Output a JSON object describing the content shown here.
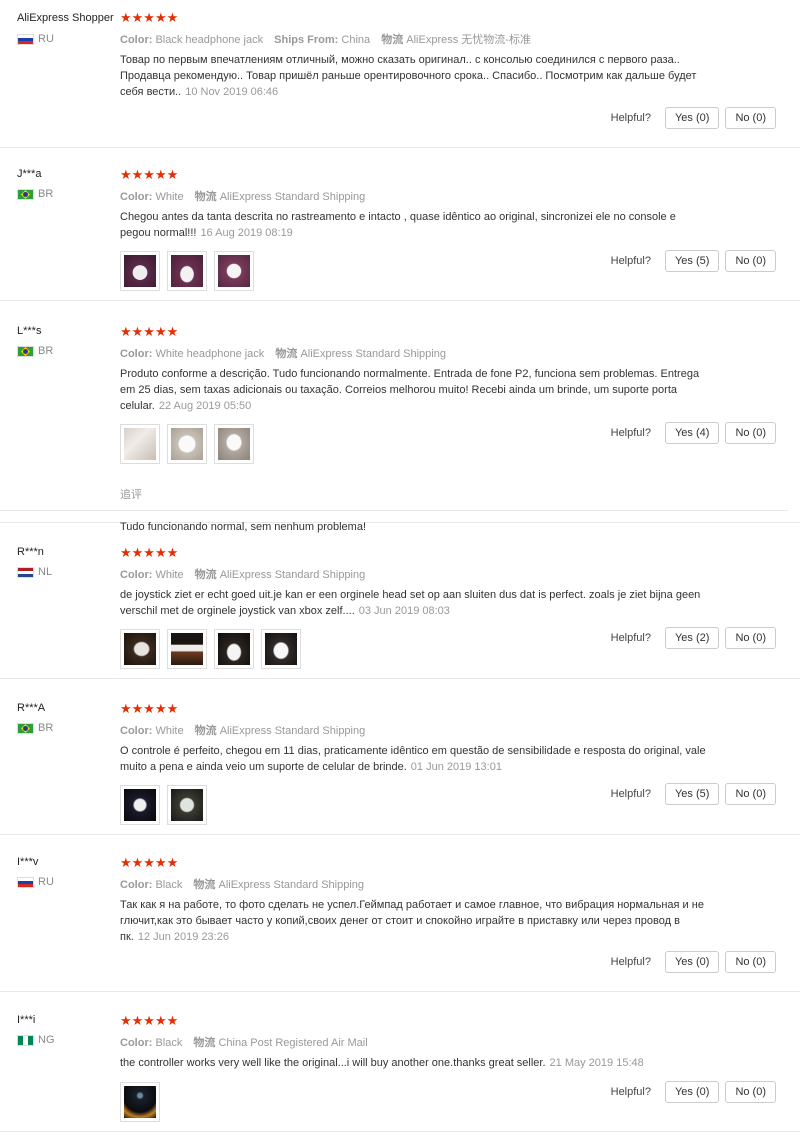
{
  "helpful_label": "Helpful?",
  "reviews": [
    {
      "user": "AliExpress Shopper",
      "country": "RU",
      "stars": "★★★★★",
      "meta": [
        [
          "Color:",
          "Black headphone jack"
        ],
        [
          "Ships From:",
          "China"
        ],
        [
          "物流",
          "AliExpress 无忧物流-标准"
        ]
      ],
      "text": "Товар по первым впечатлениям отличный, можно сказать оригинал.. с консолью соединился с первого раза.. Продавца рекомендую.. Товар пришёл раньше орентировочного срока.. Спасибо.. Посмотрим как дальше будет себя вести..",
      "date": "10 Nov 2019 06:46",
      "yes": "Yes (0)",
      "no": "No (0)"
    },
    {
      "user": "J***a",
      "country": "BR",
      "stars": "★★★★★",
      "meta": [
        [
          "Color:",
          "White"
        ],
        [
          "物流",
          "AliExpress Standard Shipping"
        ]
      ],
      "text": "Chegou antes da tanta descrita no rastreamento e intacto , quase idêntico ao original, sincronizei ele no console e pegou normal!!!",
      "date": "16 Aug 2019 08:19",
      "yes": "Yes (5)",
      "no": "No (0)"
    },
    {
      "user": "L***s",
      "country": "BR",
      "stars": "★★★★★",
      "meta": [
        [
          "Color:",
          "White headphone jack"
        ],
        [
          "物流",
          "AliExpress Standard Shipping"
        ]
      ],
      "text": "Produto conforme a descrição. Tudo funcionando normalmente. Entrada de fone P2, funciona sem problemas. Entrega em 25 dias, sem taxas adicionais ou taxação. Correios melhorou muito! Recebi ainda um brinde, um suporte porta celular.",
      "date": "22 Aug 2019 05:50",
      "yes": "Yes (4)",
      "no": "No (0)",
      "followup_label": "追评",
      "followup_text": "Tudo funcionando normal, sem nenhum problema!"
    },
    {
      "user": "R***n",
      "country": "NL",
      "stars": "★★★★★",
      "meta": [
        [
          "Color:",
          "White"
        ],
        [
          "物流",
          "AliExpress Standard Shipping"
        ]
      ],
      "text": "de joystick ziet er echt goed uit.je kan er een orginele head set op aan sluiten dus dat is perfect. zoals je ziet bijna geen verschil met de orginele joystick van xbox zelf....",
      "date": "03 Jun 2019 08:03",
      "yes": "Yes (2)",
      "no": "No (0)"
    },
    {
      "user": "R***A",
      "country": "BR",
      "stars": "★★★★★",
      "meta": [
        [
          "Color:",
          "White"
        ],
        [
          "物流",
          "AliExpress Standard Shipping"
        ]
      ],
      "text": "O controle é perfeito, chegou em 11 dias, praticamente idêntico em questão de sensibilidade e resposta do original, vale muito a pena e ainda veio um suporte de celular de brinde.",
      "date": "01 Jun 2019 13:01",
      "yes": "Yes (5)",
      "no": "No (0)"
    },
    {
      "user": "I***v",
      "country": "RU",
      "stars": "★★★★★",
      "meta": [
        [
          "Color:",
          "Black"
        ],
        [
          "物流",
          "AliExpress Standard Shipping"
        ]
      ],
      "text": "Так как я на работе, то фото сделать не успел.Геймпад работает и самое главное, что вибрация нормальная и не глючит,как это бывает часто у копий,своих денег от стоит и спокойно играйте в приставку или через провод в пк.",
      "date": "12 Jun 2019 23:26",
      "yes": "Yes (0)",
      "no": "No (0)"
    },
    {
      "user": "I***i",
      "country": "NG",
      "stars": "★★★★★",
      "meta": [
        [
          "Color:",
          "Black"
        ],
        [
          "物流",
          "China Post Registered Air Mail"
        ]
      ],
      "text": "the controller works very well like the original...i will buy another one.thanks great seller.",
      "date": "21 May 2019 15:48",
      "yes": "Yes (0)",
      "no": "No (0)"
    }
  ]
}
